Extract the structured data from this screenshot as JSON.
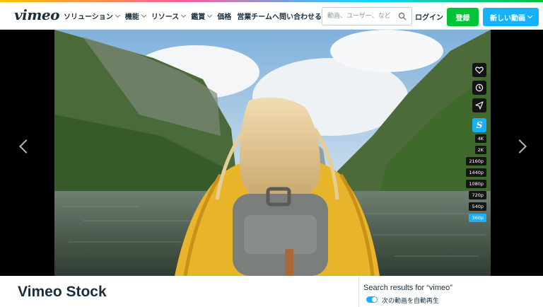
{
  "brand": {
    "logo_text": "vimeo",
    "accent": "#00c53b",
    "accent_blue": "#17b2ff"
  },
  "nav": {
    "items": [
      {
        "label": "ソリューション",
        "has_dropdown": true
      },
      {
        "label": "機能",
        "has_dropdown": true
      },
      {
        "label": "リソース",
        "has_dropdown": true
      },
      {
        "label": "鑑賞",
        "has_dropdown": true
      },
      {
        "label": "価格",
        "has_dropdown": false
      },
      {
        "label": "営業チームへ問い合わせる",
        "has_dropdown": false
      }
    ],
    "search_placeholder": "動画、ユーザー、など",
    "login": "ログイン",
    "signup": "登録",
    "new_video": "新しい動画"
  },
  "player": {
    "controls": [
      "heart-icon",
      "clock-icon",
      "send-icon",
      "stock-icon"
    ],
    "stock_badge": "S",
    "qualities": [
      "4K",
      "2K",
      "2160p",
      "1440p",
      "1080p",
      "720p",
      "540p",
      "360p"
    ],
    "active_quality": "360p"
  },
  "below_player": {
    "title": "Vimeo Stock",
    "search_results": "Search results for “vimeo”",
    "autoplay_label": "次の動画を自動再生",
    "autoplay_on": true
  }
}
